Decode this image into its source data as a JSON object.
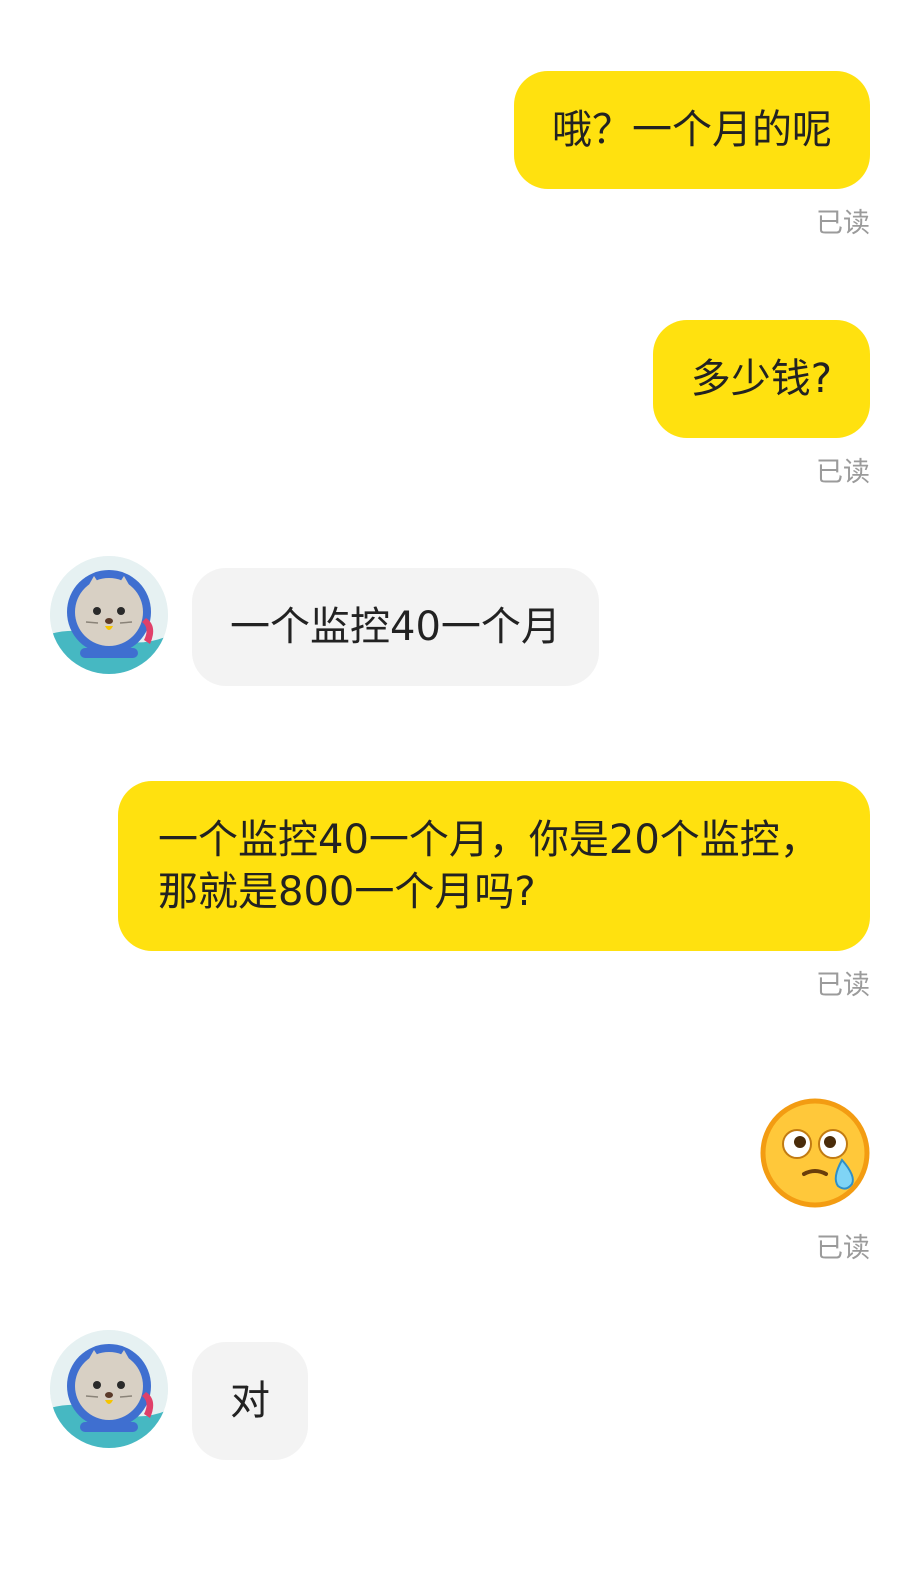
{
  "colors": {
    "sent_bubble": "#FFE10F",
    "recv_bubble": "#F3F3F3",
    "text": "#222222",
    "read_label": "#9B9B9B"
  },
  "messages": [
    {
      "side": "right",
      "text": "哦？一个月的呢",
      "status": "已读"
    },
    {
      "side": "right",
      "text": "多少钱?",
      "status": "已读"
    },
    {
      "side": "left",
      "avatar": "cat-astronaut-avatar-icon",
      "text": "一个监控40一个月"
    },
    {
      "side": "right",
      "text": "一个监控40一个月，你是20个监控，那就是800一个月吗?",
      "status": "已读"
    },
    {
      "side": "right",
      "emoji": "teary-eyed-emoji-icon",
      "status": "已读"
    },
    {
      "side": "left",
      "avatar": "cat-astronaut-avatar-icon",
      "text": "对"
    }
  ]
}
